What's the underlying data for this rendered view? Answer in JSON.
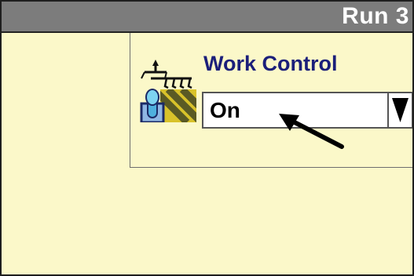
{
  "header": {
    "title": "Run 3"
  },
  "work_control": {
    "label": "Work Control",
    "selected_value": "On"
  },
  "icons": {
    "implement": "implement-work-control-icon",
    "dropdown_arrow": "triangle-down-icon",
    "pointer": "pointer-arrow-icon"
  },
  "colors": {
    "background": "#fbf8c9",
    "header": "#7c7c7c",
    "label": "#1b1f7a"
  }
}
